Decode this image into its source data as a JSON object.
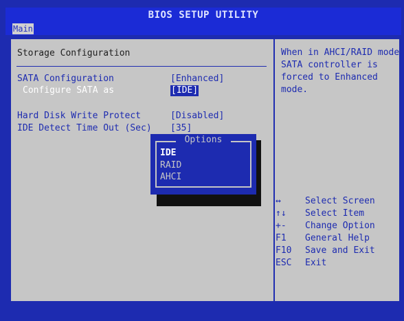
{
  "header": {
    "title": "BIOS SETUP UTILITY"
  },
  "menu": {
    "tabs": [
      {
        "label": "Main"
      }
    ]
  },
  "page": {
    "title": "Storage Configuration"
  },
  "settings": [
    {
      "label": "SATA Configuration",
      "value": "[Enhanced]"
    },
    {
      "label": "Configure SATA as",
      "value": "[IDE]"
    },
    {
      "label": "Hard Disk Write Protect",
      "value": "[Disabled]"
    },
    {
      "label": "IDE Detect Time Out (Sec)",
      "value": "[35]"
    }
  ],
  "popup": {
    "title": "Options",
    "options": [
      "IDE",
      "RAID",
      "AHCI"
    ],
    "selected": "IDE"
  },
  "help": {
    "lines": [
      "When in AHCI/RAID mode",
      "SATA controller is",
      "forced to Enhanced",
      "mode."
    ]
  },
  "keys": [
    {
      "key": "↔",
      "desc": "Select Screen"
    },
    {
      "key": "↑↓",
      "desc": "Select Item"
    },
    {
      "key": "+-",
      "desc": "Change Option"
    },
    {
      "key": "F1",
      "desc": "General Help"
    },
    {
      "key": "F10",
      "desc": "Save and Exit"
    },
    {
      "key": "ESC",
      "desc": "Exit"
    }
  ],
  "colors": {
    "background": "#1d2bb0",
    "panel": "#c6c6c6",
    "highlight": "#ffffff"
  }
}
